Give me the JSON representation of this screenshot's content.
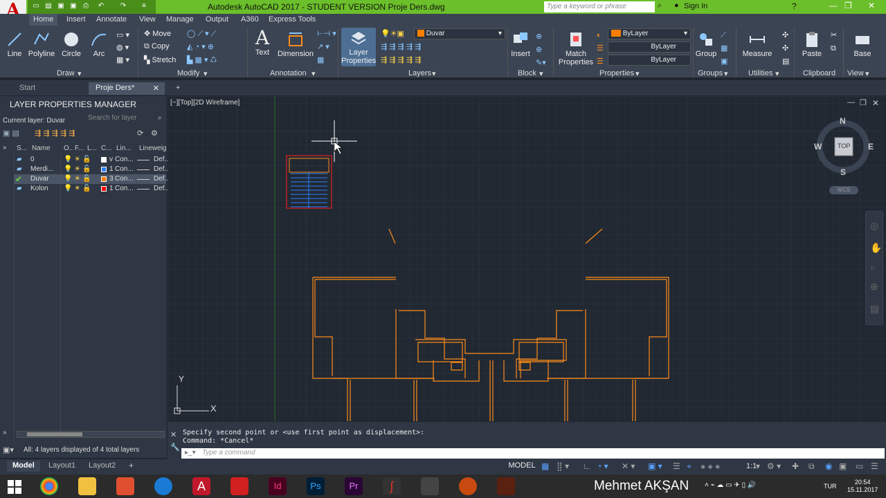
{
  "app": {
    "title": "Autodesk AutoCAD 2017 - STUDENT VERSION    Proje Ders.dwg",
    "search_placeholder": "Type a keyword or phrase",
    "sign_in": "Sign In",
    "logo": "A"
  },
  "ribbon_tabs": [
    "Home",
    "Insert",
    "Annotate",
    "View",
    "Manage",
    "Output",
    "A360",
    "Express Tools"
  ],
  "draw": {
    "line": "Line",
    "polyline": "Polyline",
    "circle": "Circle",
    "arc": "Arc",
    "panel": "Draw"
  },
  "modify": {
    "move": "Move",
    "copy": "Copy",
    "stretch": "Stretch",
    "panel": "Modify"
  },
  "annotation": {
    "text": "Text",
    "dimension": "Dimension",
    "panel": "Annotation"
  },
  "layers": {
    "layer_properties": "Layer Properties",
    "current": "Duvar",
    "panel": "Layers"
  },
  "block": {
    "insert": "Insert",
    "panel": "Block"
  },
  "properties": {
    "match": "Match Properties",
    "color": "ByLayer",
    "linetype": "ByLayer",
    "lineweight": "ByLayer",
    "panel": "Properties"
  },
  "groups": {
    "group": "Group",
    "panel": "Groups"
  },
  "utilities": {
    "measure": "Measure",
    "panel": "Utilities"
  },
  "clipboard": {
    "paste": "Paste",
    "panel": "Clipboard"
  },
  "view": {
    "base": "Base",
    "panel": "View"
  },
  "file_tabs": [
    "Start",
    "Proje Ders*"
  ],
  "lpm": {
    "title": "LAYER PROPERTIES MANAGER",
    "current_layer": "Current layer: Duvar",
    "search_placeholder": "Search for layer",
    "headers": [
      "S...",
      "Name",
      "O..",
      "F...",
      "L...",
      "C...",
      "Lin...",
      "Lineweig"
    ],
    "rows": [
      {
        "name": "0",
        "color_label": "v",
        "linetype": "Con...",
        "lineweight": "Def...",
        "color": "#ffffff"
      },
      {
        "name": "Merdi...",
        "color_label": "1",
        "linetype": "Con...",
        "lineweight": "Def...",
        "color": "#2a7fff"
      },
      {
        "name": "Duvar",
        "color_label": "3",
        "linetype": "Con...",
        "lineweight": "Def...",
        "color": "#ff7f00"
      },
      {
        "name": "Kolon",
        "color_label": "1",
        "linetype": "Con...",
        "lineweight": "Def...",
        "color": "#ff0000"
      }
    ],
    "status": "All: 4 layers displayed of 4 total layers"
  },
  "viewport": {
    "label": "[−][Top][2D Wireframe]",
    "compass": {
      "n": "N",
      "s": "S",
      "e": "E",
      "w": "W",
      "top": "TOP",
      "wcs": "WCS"
    },
    "axis_x": "X",
    "axis_y": "Y"
  },
  "command": {
    "line1": "Specify second point or <use first point as displacement>:",
    "line2": "Command: *Cancel*",
    "placeholder": "Type a command"
  },
  "layout_tabs": [
    "Model",
    "Layout1",
    "Layout2"
  ],
  "status": {
    "model": "MODEL",
    "scale": "1:1"
  },
  "taskbar": {
    "user": "Mehmet AKŞAN",
    "lang": "TUR",
    "time": "20:54",
    "date": "15.11.2017"
  },
  "colors": {
    "accent": "#6bbf2a",
    "orange": "#ff8c1a",
    "canvas": "#212832"
  }
}
